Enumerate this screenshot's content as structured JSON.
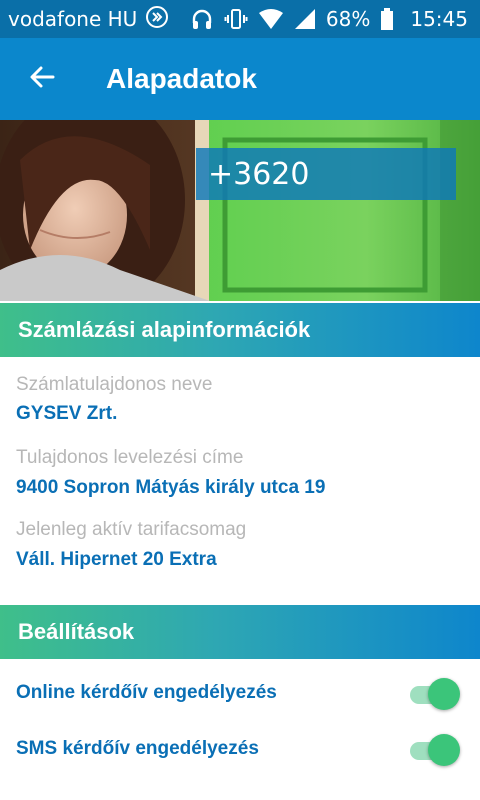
{
  "status_bar": {
    "carrier": "vodafone HU",
    "battery_percent": "68%",
    "time": "15:45"
  },
  "app_bar": {
    "title": "Alapadatok"
  },
  "hero": {
    "phone_number": "+3620"
  },
  "billing": {
    "header": "Számlázási alapinformációk",
    "fields": [
      {
        "label": "Számlatulajdonos neve",
        "value": "GYSEV Zrt."
      },
      {
        "label": "Tulajdonos levelezési címe",
        "value": "9400 Sopron Mátyás király utca 19"
      },
      {
        "label": "Jelenleg aktív tarifacsomag",
        "value": "Váll. Hipernet 20 Extra"
      }
    ]
  },
  "settings": {
    "header": "Beállítások",
    "items": [
      {
        "label": "Online kérdőív engedélyezés",
        "enabled": true
      },
      {
        "label": "SMS kérdőív engedélyezés",
        "enabled": true
      }
    ]
  },
  "colors": {
    "status_bar": "#0a6fa8",
    "app_bar": "#0b87cc",
    "value_text": "#0a6fb5",
    "label_text": "#b7b7b7",
    "toggle_on": "#3bc57a"
  }
}
